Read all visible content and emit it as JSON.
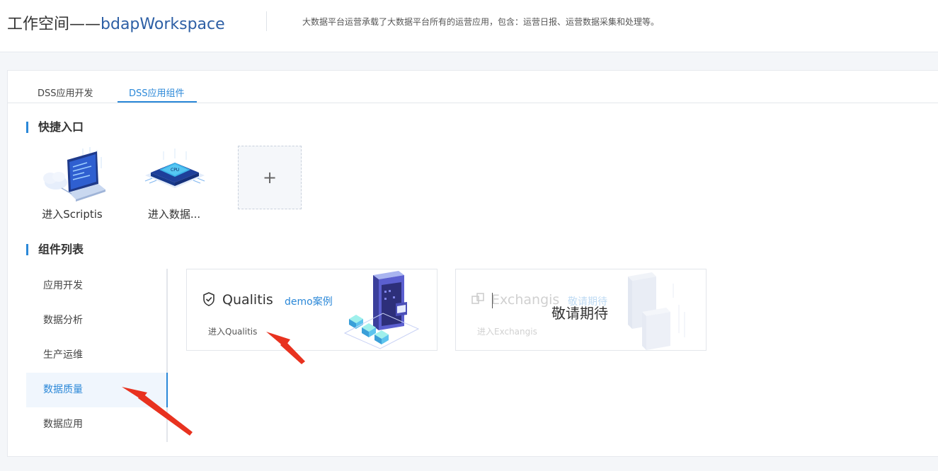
{
  "header": {
    "title_prefix": "工作空间——",
    "workspace_name": "bdapWorkspace",
    "description": "大数据平台运营承载了大数据平台所有的运营应用，包含：运营日报、运营数据采集和处理等。"
  },
  "tabs": [
    {
      "label": "DSS应用开发",
      "active": false
    },
    {
      "label": "DSS应用组件",
      "active": true
    }
  ],
  "quick_entry": {
    "title": "快捷入口",
    "items": [
      {
        "label": "进入Scriptis",
        "icon": "laptop-cloud-icon"
      },
      {
        "label": "进入数据...",
        "icon": "cpu-chip-icon"
      }
    ],
    "add_label": "+"
  },
  "component_list": {
    "title": "组件列表",
    "categories": [
      {
        "label": "应用开发",
        "active": false
      },
      {
        "label": "数据分析",
        "active": false
      },
      {
        "label": "生产运维",
        "active": false
      },
      {
        "label": "数据质量",
        "active": true
      },
      {
        "label": "数据应用",
        "active": false
      }
    ],
    "cards": [
      {
        "name": "Qualitis",
        "tag": "demo案例",
        "enter": "进入Qualitis",
        "icon": "shield-check-icon",
        "disabled": false
      },
      {
        "name": "Exchangis",
        "tag": "敬请期待",
        "enter": "进入Exchangis",
        "overlay": "敬请期待",
        "icon": "exchange-icon",
        "disabled": true
      }
    ]
  },
  "colors": {
    "accent": "#2b88d8",
    "title_blue": "#2d5fa5",
    "annotation_arrow": "#e8321f"
  }
}
